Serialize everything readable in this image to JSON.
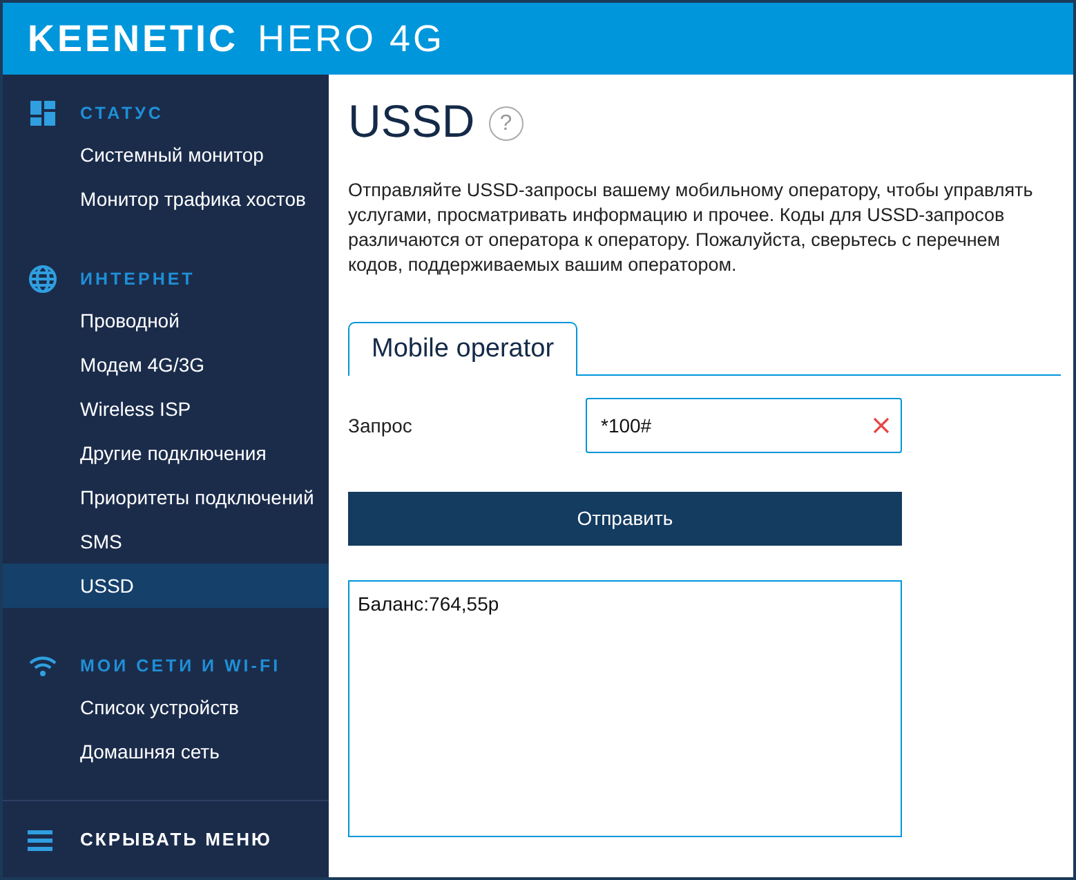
{
  "header": {
    "brand": "KEENETIC",
    "model": "HERO 4G"
  },
  "sidebar": {
    "sections": [
      {
        "title": "СТАТУС",
        "kind": "dashboard",
        "items": [
          {
            "label": "Системный монитор",
            "selected": false
          },
          {
            "label": "Монитор трафика хостов",
            "selected": false
          }
        ]
      },
      {
        "title": "ИНТЕРНЕТ",
        "kind": "globe",
        "items": [
          {
            "label": "Проводной",
            "selected": false
          },
          {
            "label": "Модем 4G/3G",
            "selected": false
          },
          {
            "label": "Wireless ISP",
            "selected": false
          },
          {
            "label": "Другие подключения",
            "selected": false
          },
          {
            "label": "Приоритеты подключений",
            "selected": false
          },
          {
            "label": "SMS",
            "selected": false
          },
          {
            "label": "USSD",
            "selected": true
          }
        ]
      },
      {
        "title": "МОИ СЕТИ И WI-FI",
        "kind": "wifi",
        "items": [
          {
            "label": "Список устройств",
            "selected": false
          },
          {
            "label": "Домашняя сеть",
            "selected": false
          }
        ]
      }
    ],
    "footer": "СКРЫВАТЬ МЕНЮ"
  },
  "page": {
    "title": "USSD",
    "help": "?",
    "description": "Отправляйте USSD-запросы вашему мобильному оператору, чтобы управлять услугами, просматривать информацию и прочее. Коды для USSD-запросов различаются от оператора к оператору. Пожалуйста, сверьтесь с перечнем кодов, поддерживаемых вашим оператором.",
    "tabs": [
      {
        "label": "Mobile operator",
        "selected": true
      }
    ],
    "form": {
      "label": "Запрос",
      "value": "*100#"
    },
    "button": "Отправить",
    "response": "Баланс:764,55р"
  }
}
